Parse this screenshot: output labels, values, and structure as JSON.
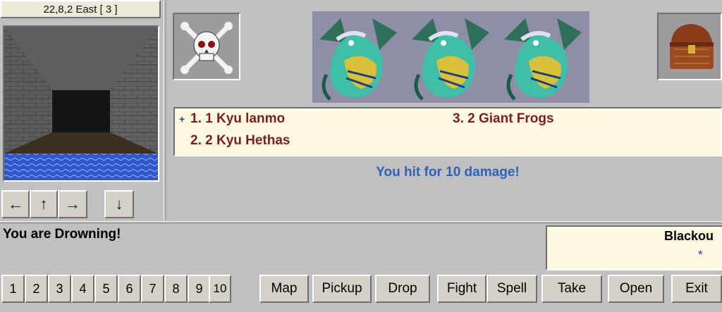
{
  "location": {
    "text": "22,8,2 East [ 3 ]"
  },
  "movement": {
    "turn_left": "←",
    "forward": "↑",
    "turn_right": "→",
    "back": "↓"
  },
  "icons": {
    "danger_icon": "skull-crossbones",
    "treasure_icon": "treasure-chest",
    "monster_portrait": "dragon-portrait"
  },
  "encounter": {
    "marker": "+",
    "items": [
      "1. 1 Kyu lanmo",
      "2. 2 Kyu Hethas",
      "3. 2 Giant Frogs"
    ]
  },
  "combat_message": "You hit for 10 damage!",
  "status_text": "You are Drowning!",
  "party": {
    "name": "Blackou",
    "marker": "*"
  },
  "toolbar": {
    "slots": [
      "1",
      "2",
      "3",
      "4",
      "5",
      "6",
      "7",
      "8",
      "9",
      "10"
    ],
    "actions": [
      "Map",
      "Pickup",
      "Drop",
      "Fight",
      "Spell",
      "Take",
      "Open",
      "Exit"
    ]
  },
  "colors": {
    "panel": "#c0c0c0",
    "list_bg": "#fdf8e0",
    "enemy_text": "#7a1e1e",
    "message_text": "#2f63b9"
  }
}
